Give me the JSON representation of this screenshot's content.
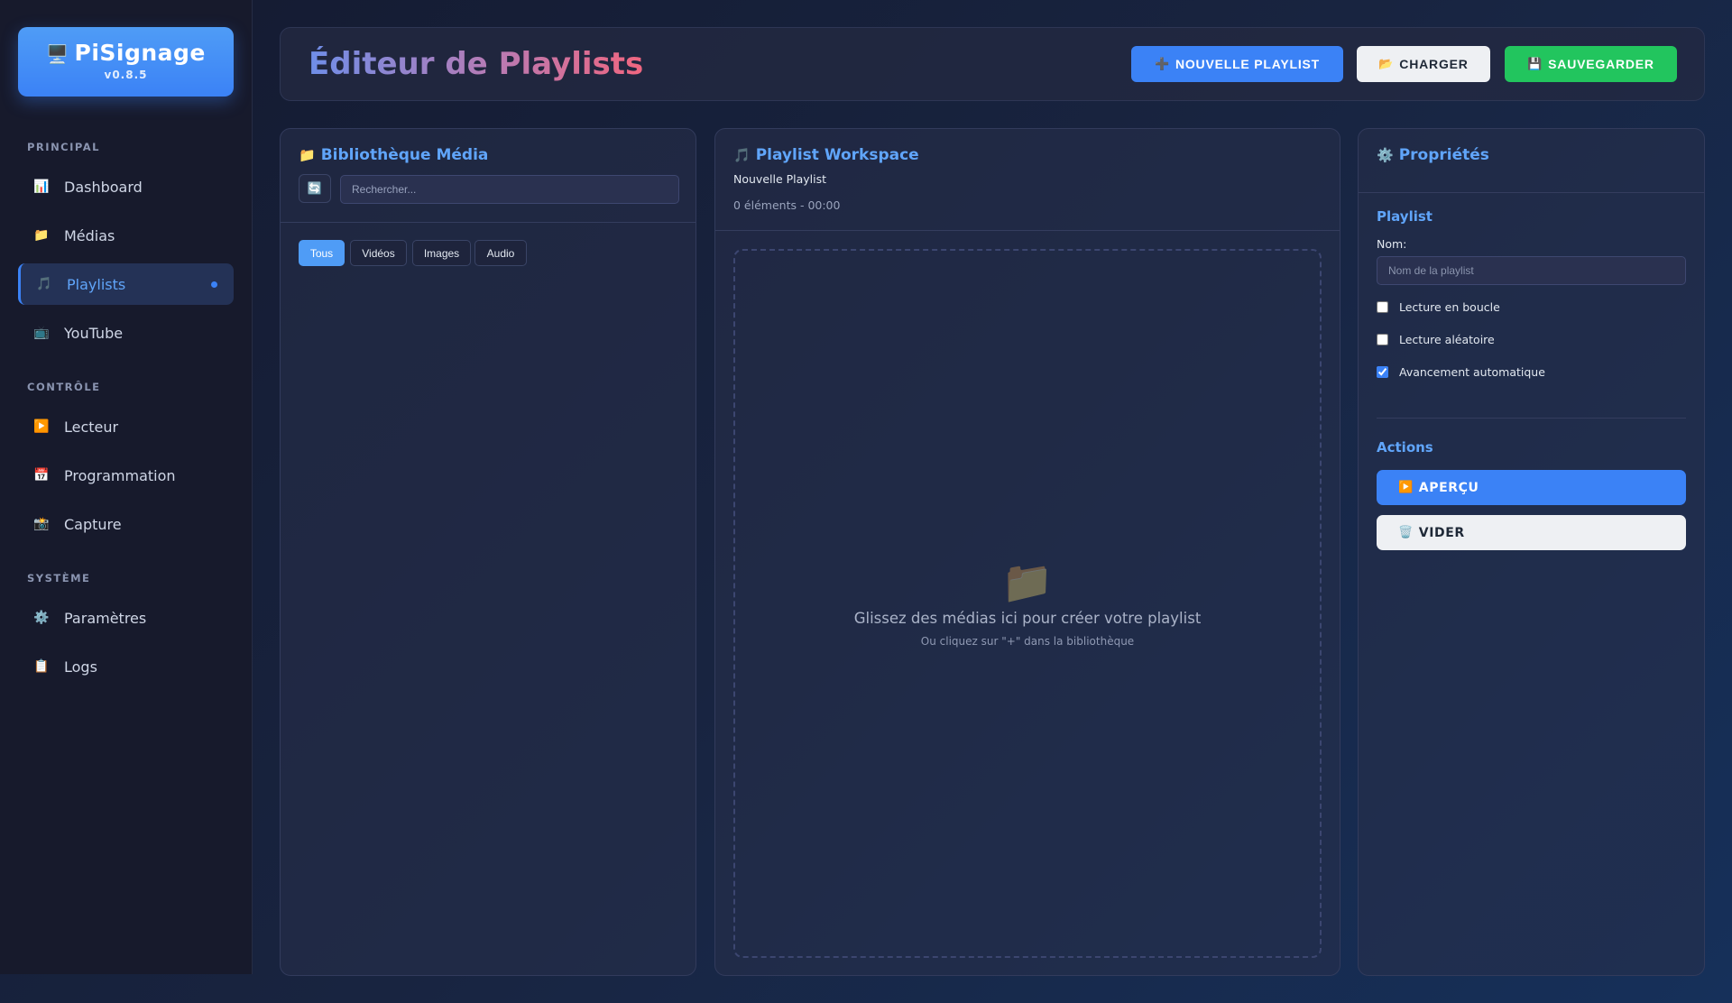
{
  "app": {
    "name": "PiSignage",
    "version": "v0.8.5",
    "logo_icon": "🖥️"
  },
  "sidebar": {
    "sections": [
      {
        "label": "PRINCIPAL"
      },
      {
        "label": "CONTRÔLE"
      },
      {
        "label": "SYSTÈME"
      }
    ],
    "items": [
      {
        "label": "Dashboard",
        "icon": "📊",
        "icon_name": "chart-icon"
      },
      {
        "label": "Médias",
        "icon": "📁",
        "icon_name": "folder-icon"
      },
      {
        "label": "Playlists",
        "icon": "🎵",
        "icon_name": "music-icon",
        "active": true
      },
      {
        "label": "YouTube",
        "icon": "📺",
        "icon_name": "tv-icon"
      },
      {
        "label": "Lecteur",
        "icon": "▶️",
        "icon_name": "play-icon"
      },
      {
        "label": "Programmation",
        "icon": "📅",
        "icon_name": "calendar-icon"
      },
      {
        "label": "Capture",
        "icon": "📸",
        "icon_name": "camera-icon"
      },
      {
        "label": "Paramètres",
        "icon": "⚙️",
        "icon_name": "gear-icon"
      },
      {
        "label": "Logs",
        "icon": "📋",
        "icon_name": "clipboard-icon"
      }
    ]
  },
  "header": {
    "title": "Éditeur de Playlists",
    "buttons": {
      "new": {
        "icon": "➕",
        "label": "NOUVELLE PLAYLIST"
      },
      "load": {
        "icon": "📂",
        "label": "CHARGER"
      },
      "save": {
        "icon": "💾",
        "label": "SAUVEGARDER"
      }
    }
  },
  "library": {
    "icon": "📁",
    "title": "Bibliothèque Média",
    "refresh_icon": "🔄",
    "search_placeholder": "Rechercher...",
    "filters": [
      "Tous",
      "Vidéos",
      "Images",
      "Audio"
    ],
    "active_filter": "Tous"
  },
  "workspace": {
    "icon": "🎵",
    "title": "Playlist Workspace",
    "playlist_name": "Nouvelle Playlist",
    "summary": "0 éléments - 00:00",
    "drop_icon": "📁",
    "drop_text": "Glissez des médias ici pour créer votre playlist",
    "drop_subtext": "Ou cliquez sur \"+\" dans la bibliothèque"
  },
  "properties": {
    "icon": "⚙️",
    "title": "Propriétés",
    "playlist_section": "Playlist",
    "name_label": "Nom:",
    "name_placeholder": "Nom de la playlist",
    "options": [
      {
        "label": "Lecture en boucle",
        "checked": false
      },
      {
        "label": "Lecture aléatoire",
        "checked": false
      },
      {
        "label": "Avancement automatique",
        "checked": true
      }
    ],
    "actions_section": "Actions",
    "actions": {
      "preview": {
        "icon": "▶️",
        "label": "APERÇU"
      },
      "clear": {
        "icon": "🗑️",
        "label": "VIDER"
      }
    }
  },
  "colors": {
    "accent": "#3b82f6",
    "success": "#22c55e",
    "sidebar_bg": "#171a2c"
  }
}
